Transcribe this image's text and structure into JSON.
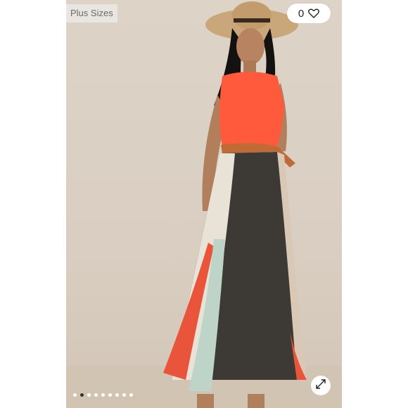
{
  "tag": {
    "label": "Plus Sizes"
  },
  "like": {
    "count": "0",
    "icon": "heart-icon"
  },
  "expand": {
    "icon": "expand-icon"
  },
  "carousel": {
    "total_slides": 9,
    "active_slide": 2
  },
  "colors": {
    "background": "#ffffff",
    "photo_bg": "#ddd3c7",
    "top": "#ff5a3c",
    "belt": "#c06a35"
  }
}
